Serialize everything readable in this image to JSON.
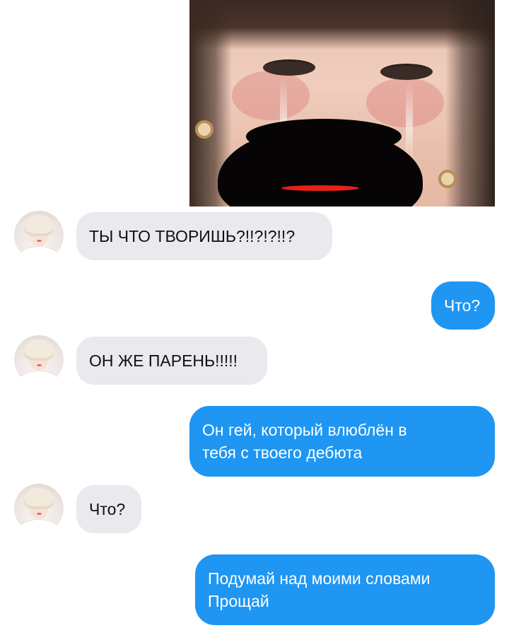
{
  "conversation": {
    "messages": [
      {
        "sender": "contact",
        "text": "ТЫ ЧТО ТВОРИШЬ?!!?!?!!?"
      },
      {
        "sender": "me",
        "text": "Что?"
      },
      {
        "sender": "contact",
        "text": "ОН ЖЕ ПАРЕНЬ!!!!!"
      },
      {
        "sender": "me",
        "text": "Он гей, который влюблён в\nтебя с твоего дебюта"
      },
      {
        "sender": "contact",
        "text": "Что?"
      },
      {
        "sender": "me",
        "text": "Подумай над моими словами\nПрощай"
      }
    ]
  },
  "colors": {
    "outgoing_bubble": "#1e96f2",
    "incoming_bubble": "#e9e9ee",
    "redaction": "#060404"
  },
  "icons": {
    "avatar": "contact-avatar-photo"
  }
}
